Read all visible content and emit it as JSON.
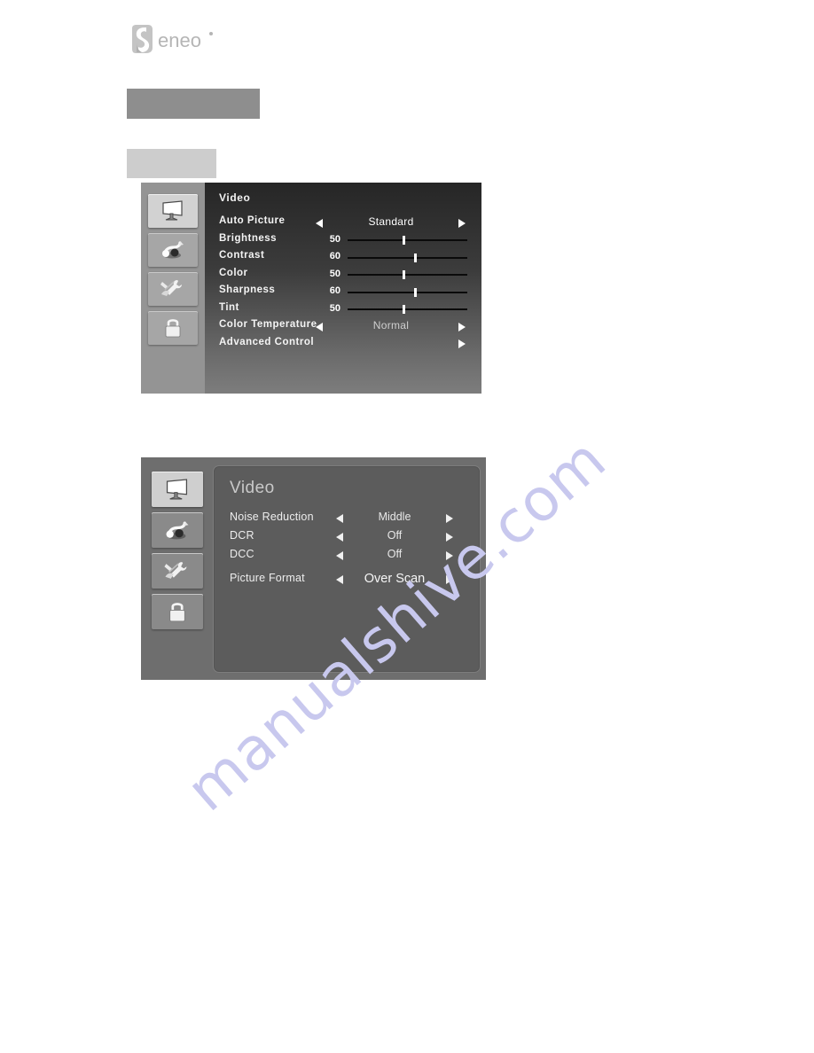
{
  "brand": {
    "logo_text": "eneo",
    "logo_mark": "eneo-swirl-camera-mark"
  },
  "redacted_bars": {
    "heading_bar_label": "",
    "subheading_bar_label": ""
  },
  "watermark": {
    "text": "manualshive.com",
    "color": "#c8c8ee"
  },
  "osd_menu_1": {
    "title": "Video",
    "sidebar": [
      {
        "name": "display-icon",
        "selected": true
      },
      {
        "name": "audio-icon",
        "selected": false
      },
      {
        "name": "tools-icon",
        "selected": false
      },
      {
        "name": "lock-icon",
        "selected": false
      }
    ],
    "rows": [
      {
        "label": "Auto Picture",
        "type": "option",
        "value": "Standard",
        "dim": false
      },
      {
        "label": "Brightness",
        "type": "slider",
        "value": 50
      },
      {
        "label": "Contrast",
        "type": "slider",
        "value": 60
      },
      {
        "label": "Color",
        "type": "slider",
        "value": 50
      },
      {
        "label": "Sharpness",
        "type": "slider",
        "value": 60
      },
      {
        "label": "Tint",
        "type": "slider",
        "value": 50
      },
      {
        "label": "Color Temperature",
        "type": "option",
        "value": "Normal",
        "dim": true
      },
      {
        "label": "Advanced Control",
        "type": "submenu",
        "value": ""
      }
    ]
  },
  "osd_menu_2": {
    "title": "Video",
    "sidebar": [
      {
        "name": "display-icon",
        "selected": true
      },
      {
        "name": "audio-icon",
        "selected": false
      },
      {
        "name": "tools-icon",
        "selected": false
      },
      {
        "name": "lock-icon",
        "selected": false
      }
    ],
    "rows": [
      {
        "label": "Noise Reduction",
        "value": "Middle",
        "big": false
      },
      {
        "label": "DCR",
        "value": "Off",
        "big": false
      },
      {
        "label": "DCC",
        "value": "Off",
        "big": false
      },
      {
        "label": "Picture Format",
        "value": "Over Scan",
        "big": true
      }
    ]
  }
}
